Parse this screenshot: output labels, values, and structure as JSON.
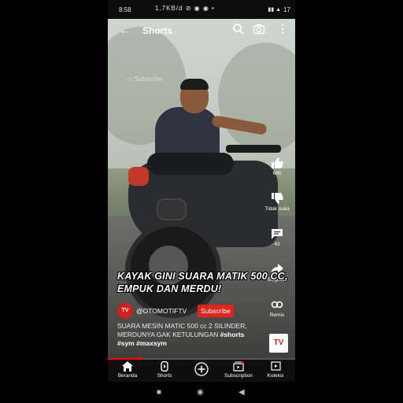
{
  "status_bar": {
    "time": "8:58",
    "speed": "1,7KB/d",
    "battery": "17"
  },
  "header": {
    "title": "Shorts",
    "icons": [
      "back-arrow-icon",
      "search-icon",
      "camera-icon",
      "more-vert-icon"
    ]
  },
  "video": {
    "watermark": "Subscribe"
  },
  "side_actions": {
    "like_count": "680",
    "dislike_label": "Tidak suka",
    "comment_count": "43",
    "share_label": "Bagikan",
    "remix_label": "Remix"
  },
  "caption": {
    "line1": "KAYAK GINI SUARA MATIK 500 CC,",
    "line2": "EMPUK DAN MERDU!"
  },
  "channel": {
    "avatar_text": "TV",
    "name": "@OTOMOTIFTV",
    "subscribe_label": "Subscribe"
  },
  "description": {
    "line1": "SUARA MESIN MATIC 500 cc 2 SILINDER,",
    "line2_text": "MERDUNYA GAK KETULUNGAN ",
    "line2_tag": "#shorts",
    "line3": "#sym #maxsym"
  },
  "progress": {
    "fraction": 0.17,
    "color": "#ff0000"
  },
  "bottom_nav": [
    {
      "label": "Beranda",
      "icon": "home-icon"
    },
    {
      "label": "Shorts",
      "icon": "shorts-icon"
    },
    {
      "label": "",
      "icon": "add-icon"
    },
    {
      "label": "Subscription",
      "icon": "subscriptions-icon"
    },
    {
      "label": "Koleksi",
      "icon": "library-icon"
    }
  ],
  "colors": {
    "accent": "#e0241b",
    "background": "#0f0f0f"
  }
}
